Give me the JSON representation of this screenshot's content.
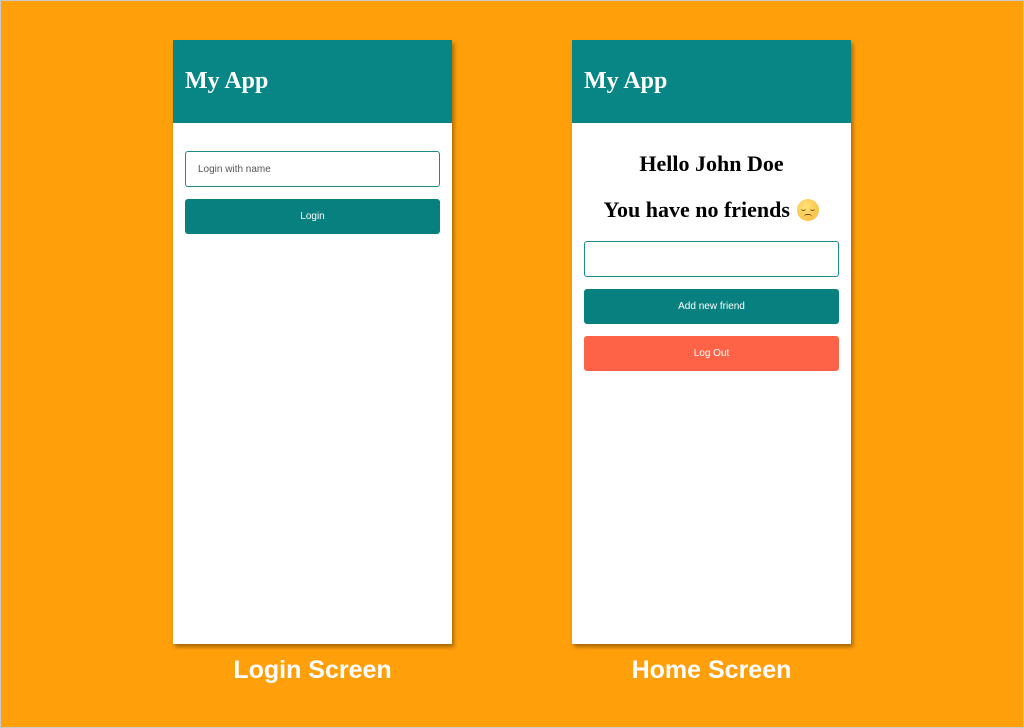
{
  "colors": {
    "background": "#FF9F0A",
    "header": "#088585",
    "primary_button": "#088080",
    "logout_button": "#FF6347"
  },
  "login_screen": {
    "header_title": "My App",
    "name_input": {
      "placeholder": "Login with name",
      "value": ""
    },
    "login_button_label": "Login",
    "caption": "Login Screen"
  },
  "home_screen": {
    "header_title": "My App",
    "greeting": "Hello John Doe",
    "friends_message": "You have no friends",
    "friends_message_icon": "pensive-face-emoji",
    "friend_input": {
      "placeholder": "",
      "value": ""
    },
    "add_friend_button_label": "Add new friend",
    "logout_button_label": "Log Out",
    "caption": "Home Screen"
  }
}
